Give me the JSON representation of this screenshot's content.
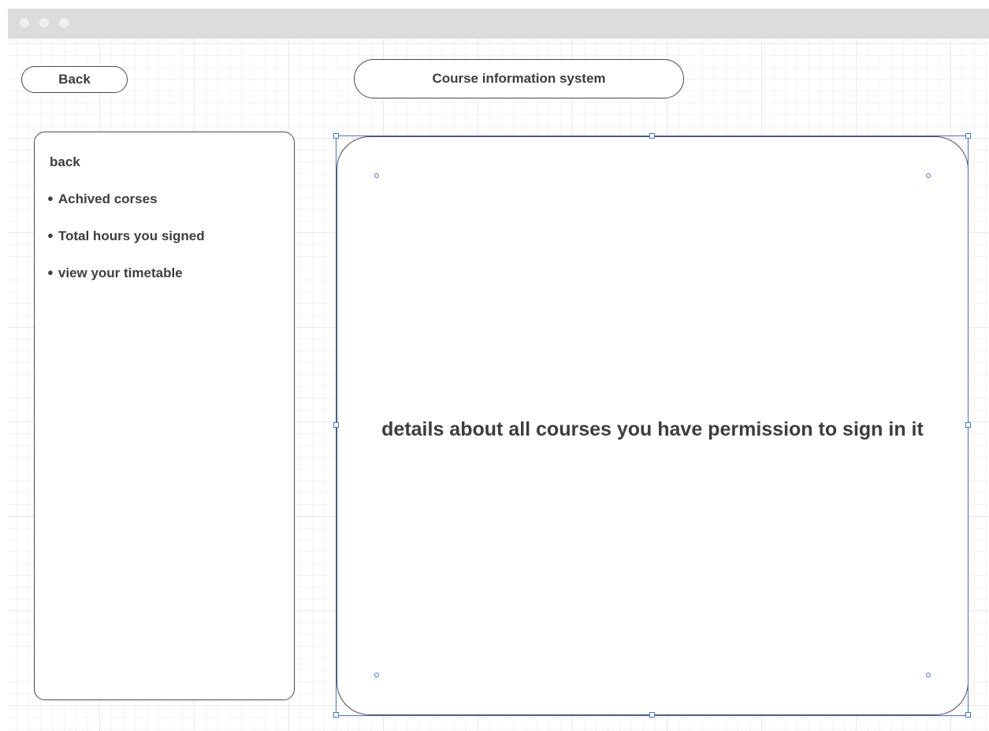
{
  "window": {
    "controls": [
      "close-dot",
      "minimize-dot",
      "maximize-dot"
    ]
  },
  "header": {
    "back_label": "Back",
    "title": "Course information system"
  },
  "sidebar": {
    "back_label": "back",
    "items": [
      {
        "label": "Achived corses"
      },
      {
        "label": "Total hours you signed"
      },
      {
        "label": "view your timetable"
      }
    ]
  },
  "main": {
    "details_text": "details about all courses you have permission to sign in it"
  },
  "colors": {
    "selection": "#4a6fd1",
    "text": "#3d3d3d",
    "border": "#4a4a4a",
    "titlebar": "#dcdcdc"
  }
}
